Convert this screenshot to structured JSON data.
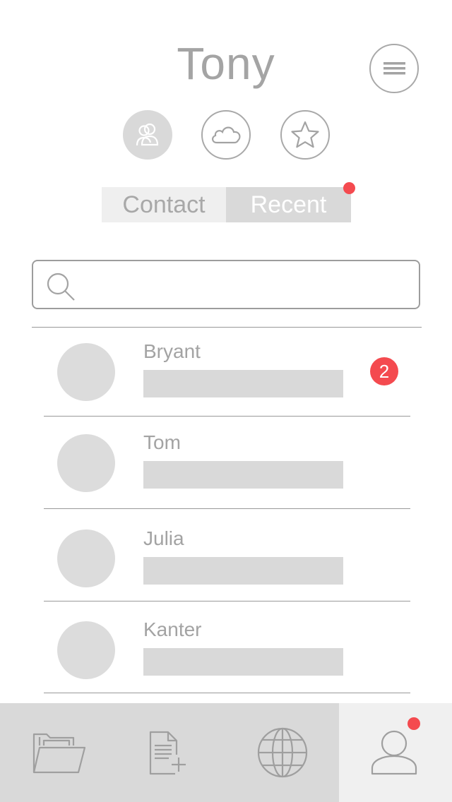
{
  "header": {
    "title": "Tony",
    "menu_icon": "hamburger-menu-icon"
  },
  "quick_actions": [
    {
      "icon": "contacts-icon",
      "selected": true
    },
    {
      "icon": "cloud-icon",
      "selected": false
    },
    {
      "icon": "star-icon",
      "selected": false
    }
  ],
  "segmented": {
    "contact_label": "Contact",
    "recent_label": "Recent",
    "selected": "Recent",
    "has_notification_dot": true
  },
  "search": {
    "placeholder": "",
    "value": "",
    "icon": "search-icon"
  },
  "conversations": [
    {
      "name": "Bryant",
      "unread": "2"
    },
    {
      "name": "Tom",
      "unread": ""
    },
    {
      "name": "Julia",
      "unread": ""
    },
    {
      "name": "Kanter",
      "unread": ""
    }
  ],
  "tabbar": {
    "tabs": [
      {
        "icon": "folder-icon",
        "active": false
      },
      {
        "icon": "new-document-icon",
        "active": false
      },
      {
        "icon": "globe-icon",
        "active": false
      },
      {
        "icon": "user-profile-icon",
        "active": true,
        "notification_dot": true
      }
    ]
  },
  "colors": {
    "accent_red": "#f44a4f",
    "gray_fill": "#d9d9d9",
    "text_gray": "#a4a4a4",
    "line_gray": "#999999"
  }
}
